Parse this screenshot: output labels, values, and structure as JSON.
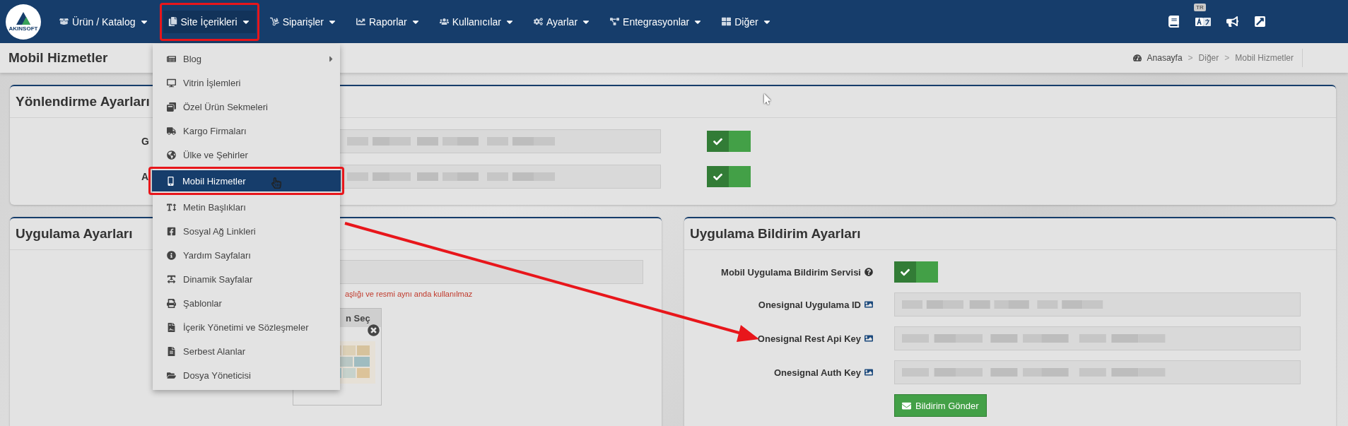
{
  "nav": {
    "logo_text": "AKINSOFT",
    "language": "TR",
    "items": [
      {
        "label": "Ürün / Katalog",
        "selected": false,
        "highlighted": false
      },
      {
        "label": "Site İçerikleri",
        "selected": true,
        "highlighted": true
      },
      {
        "label": "Siparişler",
        "selected": false,
        "highlighted": false
      },
      {
        "label": "Raporlar",
        "selected": false,
        "highlighted": false
      },
      {
        "label": "Kullanıcılar",
        "selected": false,
        "highlighted": false
      },
      {
        "label": "Ayarlar",
        "selected": false,
        "highlighted": false
      },
      {
        "label": "Entegrasyonlar",
        "selected": false,
        "highlighted": false
      },
      {
        "label": "Diğer",
        "selected": false,
        "highlighted": false
      }
    ]
  },
  "dropdown": {
    "items": [
      {
        "label": "Blog",
        "selected": false,
        "submenu": true
      },
      {
        "label": "Vitrin İşlemleri",
        "selected": false,
        "submenu": false
      },
      {
        "label": "Özel Ürün Sekmeleri",
        "selected": false,
        "submenu": false
      },
      {
        "label": "Kargo Firmaları",
        "selected": false,
        "submenu": false
      },
      {
        "label": "Ülke ve Şehirler",
        "selected": false,
        "submenu": false
      },
      {
        "label": "Mobil Hizmetler",
        "selected": true,
        "submenu": false
      },
      {
        "label": "Metin Başlıkları",
        "selected": false,
        "submenu": false
      },
      {
        "label": "Sosyal Ağ Linkleri",
        "selected": false,
        "submenu": false
      },
      {
        "label": "Yardım Sayfaları",
        "selected": false,
        "submenu": false
      },
      {
        "label": "Dinamik Sayfalar",
        "selected": false,
        "submenu": false
      },
      {
        "label": "Şablonlar",
        "selected": false,
        "submenu": false
      },
      {
        "label": "İçerik Yönetimi ve Sözleşmeler",
        "selected": false,
        "submenu": false
      },
      {
        "label": "Serbest Alanlar",
        "selected": false,
        "submenu": false
      },
      {
        "label": "Dosya Yöneticisi",
        "selected": false,
        "submenu": false
      }
    ]
  },
  "page_title": "Mobil Hizmetler",
  "breadcrumb": [
    {
      "label": "Anasayfa"
    },
    {
      "separator": ">",
      "label": "Diğer"
    },
    {
      "separator": ">",
      "label": "Mobil Hizmetler"
    }
  ],
  "redirect_panel": {
    "title": "Yönlendirme Ayarları",
    "rows": [
      {
        "label": "G",
        "on": true
      },
      {
        "label": "A",
        "on": true
      }
    ]
  },
  "app_panel": {
    "title": "Uygulama Ayarları",
    "hint": "aşlığı ve resmi aynı anda kullanılmaz",
    "picker_title": "n Seç"
  },
  "notify_panel": {
    "title": "Uygulama Bildirim Ayarları",
    "service": {
      "label": "Mobil Uygulama Bildirim Servisi",
      "on": true
    },
    "fields": [
      "Onesignal Uygulama ID",
      "Onesignal Rest Api Key",
      "Onesignal Auth Key"
    ],
    "button": "Bildirim Gönder"
  }
}
